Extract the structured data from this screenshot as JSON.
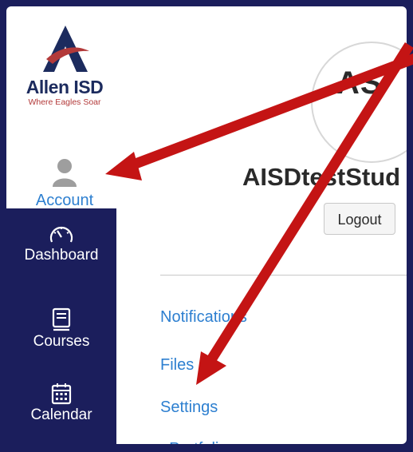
{
  "logo": {
    "name": "Allen ISD",
    "tagline": "Where Eagles Soar"
  },
  "account": {
    "label": "Account"
  },
  "nav": {
    "items": [
      {
        "label": "Dashboard",
        "icon": "dashboard-gauge-icon"
      },
      {
        "label": "Courses",
        "icon": "book-icon"
      },
      {
        "label": "Calendar",
        "icon": "calendar-icon"
      }
    ]
  },
  "profile": {
    "initials": "AS",
    "username": "AISDtestStud",
    "logout_label": "Logout"
  },
  "links": {
    "notifications": "Notifications",
    "files": "Files",
    "settings": "Settings",
    "portfolios": "ePortfolios"
  },
  "colors": {
    "nav_bg": "#1b1e5c",
    "link": "#2d7fd0",
    "arrow": "#c41414"
  }
}
